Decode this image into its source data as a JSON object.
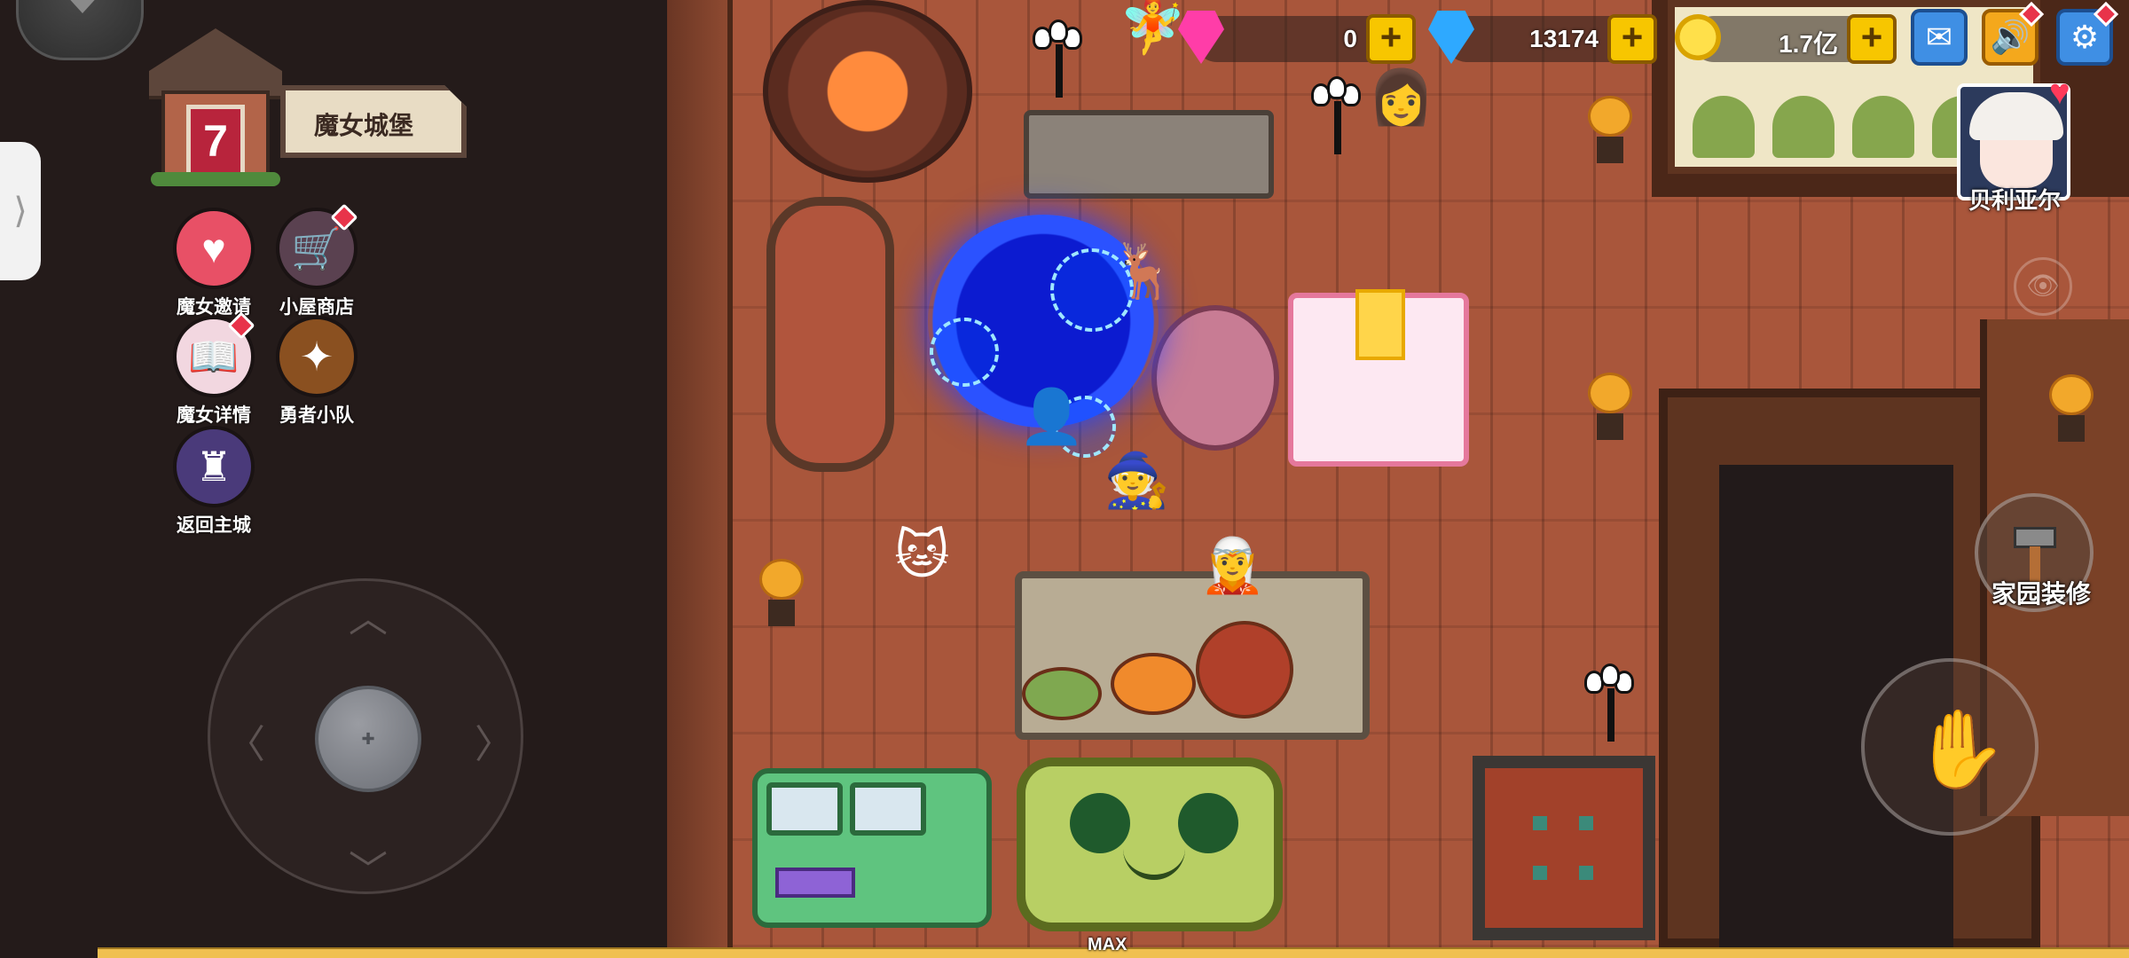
{
  "home": {
    "level": "7",
    "name": "魔女城堡"
  },
  "menu": [
    {
      "label": "魔女邀请",
      "icon": "heart-potion-icon",
      "badge": false
    },
    {
      "label": "小屋商店",
      "icon": "shop-cart-icon",
      "badge": true
    },
    {
      "label": "魔女详情",
      "icon": "witch-profile-icon",
      "badge": true
    },
    {
      "label": "勇者小队",
      "icon": "hero-team-icon",
      "badge": false
    },
    {
      "label": "返回主城",
      "icon": "castle-icon",
      "badge": false
    }
  ],
  "resources": {
    "pink_gem": "0",
    "blue_gem": "13174",
    "gold": "1.7亿"
  },
  "character": {
    "name": "贝利亚尔"
  },
  "actions": {
    "decorate_label": "家园装修"
  },
  "exp": {
    "label": "MAX",
    "progress": 1.0
  },
  "colors": {
    "floor": "#a9563b",
    "left_panel": "#241b1a",
    "plus_button": "#f7c600",
    "mail_button": "#3f8fe4",
    "sound_button": "#f4a81c",
    "badge_red": "#e8334a"
  }
}
